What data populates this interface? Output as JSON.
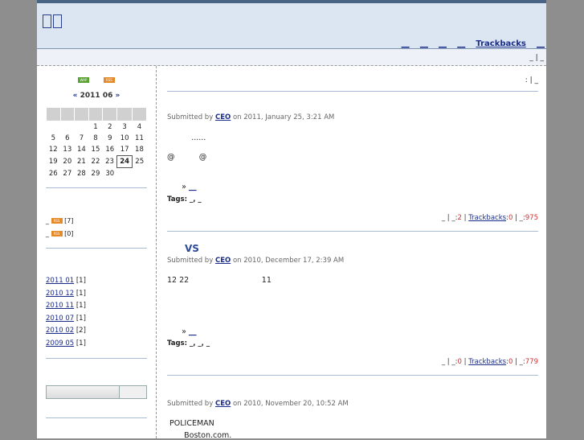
{
  "header": {
    "nav": [
      "__",
      "__",
      "__",
      "__",
      "Trackbacks",
      "__"
    ],
    "subbar_right": "_ | _"
  },
  "sidebar": {
    "badges": [
      {
        "text": "WAP",
        "color": "#5aa332"
      },
      {
        "text": "RSS",
        "color": "#e58a2a"
      }
    ],
    "calendar": {
      "prev": "«",
      "title": "2011 06",
      "next": "»",
      "weeks": [
        [
          "",
          "",
          "",
          "1",
          "2",
          "3",
          "4"
        ],
        [
          "5",
          "6",
          "7",
          "8",
          "9",
          "10",
          "11"
        ],
        [
          "12",
          "13",
          "14",
          "15",
          "16",
          "17",
          "18"
        ],
        [
          "19",
          "20",
          "21",
          "22",
          "23",
          "24",
          "25"
        ],
        [
          "26",
          "27",
          "28",
          "29",
          "30",
          "",
          ""
        ]
      ],
      "today": "24"
    },
    "categories": [
      {
        "label": "_",
        "badge": "RSS",
        "count": "[7]"
      },
      {
        "label": "_",
        "badge": "RSS",
        "count": "[0]"
      }
    ],
    "archives": [
      {
        "label": "2011 01",
        "count": "[1]"
      },
      {
        "label": "2010 12",
        "count": "[1]"
      },
      {
        "label": "2010 11",
        "count": "[1]"
      },
      {
        "label": "2010 07",
        "count": "[1]"
      },
      {
        "label": "2010 02",
        "count": "[2]"
      },
      {
        "label": "2009 05",
        "count": "[1]"
      }
    ]
  },
  "main": {
    "topright": ":   | _",
    "posts": [
      {
        "title": "",
        "submitted_by": "Submitted by",
        "author": "CEO",
        "date": "on 2011, January 25, 3:21 AM",
        "body": [
          "          ......",
          "",
          "@          @"
        ],
        "more_prefix": "»",
        "more_link": "__",
        "tags_label": "Tags",
        "tags": ": _, _",
        "footer": {
          "a": "_",
          "b": "_:",
          "comments": "2",
          "trackbacks_label": "Trackbacks",
          "trackbacks": "0",
          "c": "_:",
          "views": "975"
        }
      },
      {
        "title": "VS",
        "submitted_by": "Submitted by",
        "author": "CEO",
        "date": "on 2010, December 17, 2:39 AM",
        "body": [
          "12 22                              11"
        ],
        "more_prefix": "»",
        "more_link": "__",
        "tags_label": "Tags",
        "tags": ": _, _, _",
        "footer": {
          "a": "_",
          "b": "_:",
          "comments": "0",
          "trackbacks_label": "Trackbacks",
          "trackbacks": "0",
          "c": "_:",
          "views": "779"
        }
      },
      {
        "title": "",
        "submitted_by": "Submitted by",
        "author": "CEO",
        "date": "on 2010, November 20, 10:52 AM",
        "body": [
          " POLICEMAN",
          "       Boston.com."
        ]
      }
    ]
  }
}
